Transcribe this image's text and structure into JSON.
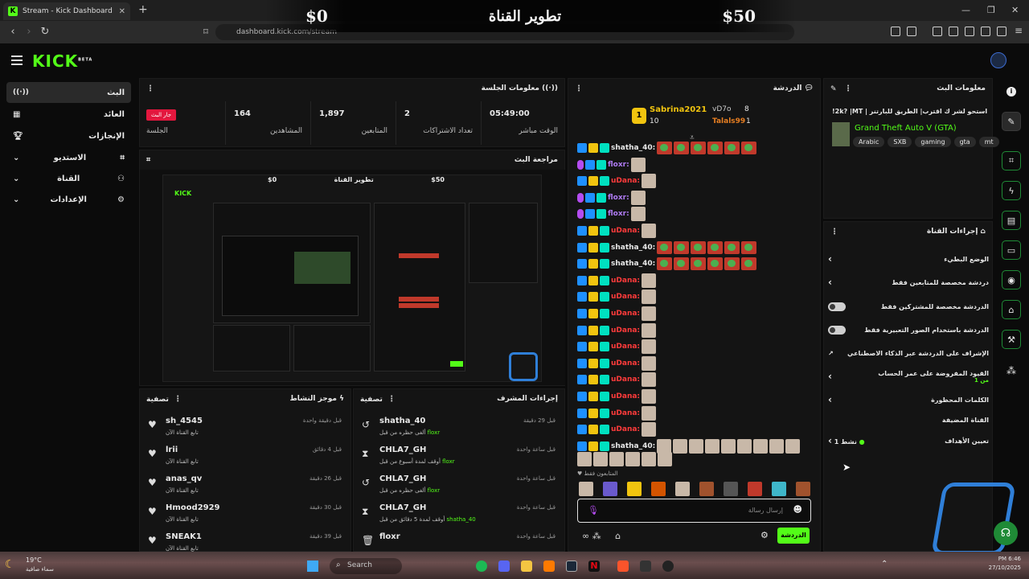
{
  "browser": {
    "tab_title": "Stream - Kick Dashboard",
    "url": "dashboard.kick.com/stream",
    "new_tab": "+"
  },
  "banner": {
    "left": "$0",
    "center": "تطوير القناة",
    "right": "$50"
  },
  "app": {
    "logo": "KICK",
    "logo_tag": "BETA"
  },
  "sidebar": {
    "items": [
      {
        "label": "البث",
        "icon": "broadcast-icon",
        "active": true
      },
      {
        "label": "العائد",
        "icon": "revenue-icon"
      },
      {
        "label": "الإنجازات",
        "icon": "trophy-icon"
      },
      {
        "label": "الاستديو",
        "icon": "studio-icon"
      },
      {
        "label": "القناة",
        "icon": "channel-icon"
      },
      {
        "label": "الإعدادات",
        "icon": "settings-icon"
      }
    ]
  },
  "session": {
    "title": "معلومات الجلسة",
    "live_badge": "جار البث",
    "session_label": "الجلسة",
    "stats": [
      {
        "value": "164",
        "label": "المشاهدين"
      },
      {
        "value": "1,897",
        "label": "المتابعين"
      },
      {
        "value": "2",
        "label": "تعداد الاشتراكات"
      },
      {
        "value": "05:49:00",
        "label": "الوقت مباشر"
      }
    ]
  },
  "preview": {
    "title": "مراجعة البث",
    "inner_left": "$0",
    "inner_center": "تطوير القناة",
    "inner_right": "$50"
  },
  "activity": {
    "title": "موجز النشاط",
    "filter": "تصفية",
    "rows": [
      {
        "name": "sh_4545",
        "sub": "تابع القناة الآن",
        "time": "قبل دقيقة واحدة"
      },
      {
        "name": "lrii",
        "sub": "تابع القناة الآن",
        "time": "قبل 4 دقائق"
      },
      {
        "name": "anas_qv",
        "sub": "تابع القناة الآن",
        "time": "قبل 26 دقيقة"
      },
      {
        "name": "Hmood2929",
        "sub": "تابع القناة الآن",
        "time": "قبل 30 دقيقة"
      },
      {
        "name": "SNEAK1",
        "sub": "تابع القناة الآن",
        "time": "قبل 39 دقيقة"
      }
    ]
  },
  "modactions": {
    "title": "إجراءات المشرف",
    "filter": "تصفية",
    "rows": [
      {
        "name": "shatha_40",
        "sub": "ألغى حظره من قبل",
        "by": "floxr",
        "time": "قبل 29 دقيقة",
        "icon": "undo-icon"
      },
      {
        "name": "CHLA7_GH",
        "sub": "أوقف لمدة أسبوع من قبل",
        "by": "floxr",
        "time": "قبل ساعة واحدة",
        "icon": "hourglass-icon"
      },
      {
        "name": "CHLA7_GH",
        "sub": "ألغى حظره من قبل",
        "by": "floxr",
        "time": "قبل ساعة واحدة",
        "icon": "undo-icon"
      },
      {
        "name": "CHLA7_GH",
        "sub": "أوقف لمدة 5 دقائق من قبل",
        "by": "shatha_40",
        "time": "قبل ساعة واحدة",
        "icon": "hourglass-icon"
      },
      {
        "name": "floxr",
        "sub": "",
        "by": "",
        "time": "قبل ساعة واحدة",
        "icon": "trash-icon"
      }
    ]
  },
  "chat": {
    "title": "الدردشة",
    "leaders": [
      {
        "name": "Sabrina2021",
        "value": "10"
      },
      {
        "name": "vD7o",
        "value": "8"
      },
      {
        "name": "Talals99",
        "value": "1"
      }
    ],
    "rank_badge": "1",
    "lines": [
      {
        "user": "shatha_40:",
        "color": "white",
        "type": "emotes"
      },
      {
        "user": "floxr:",
        "color": "purple",
        "type": "face"
      },
      {
        "user": "uDana:",
        "color": "red",
        "type": "face"
      },
      {
        "user": "floxr:",
        "color": "purple",
        "type": "face"
      },
      {
        "user": "floxr:",
        "color": "purple",
        "type": "face"
      },
      {
        "user": "uDana:",
        "color": "red",
        "type": "face"
      },
      {
        "user": "shatha_40:",
        "color": "white",
        "type": "emotes"
      },
      {
        "user": "shatha_40:",
        "color": "white",
        "type": "emotes"
      },
      {
        "user": "uDana:",
        "color": "red",
        "type": "face"
      },
      {
        "user": "uDana:",
        "color": "red",
        "type": "face"
      },
      {
        "user": "uDana:",
        "color": "red",
        "type": "face"
      },
      {
        "user": "uDana:",
        "color": "red",
        "type": "face"
      },
      {
        "user": "uDana:",
        "color": "red",
        "type": "face"
      },
      {
        "user": "uDana:",
        "color": "red",
        "type": "face"
      },
      {
        "user": "uDana:",
        "color": "red",
        "type": "face"
      },
      {
        "user": "uDana:",
        "color": "red",
        "type": "face"
      },
      {
        "user": "uDana:",
        "color": "red",
        "type": "face"
      },
      {
        "user": "uDana:",
        "color": "red",
        "type": "face"
      },
      {
        "user": "shatha_40:",
        "color": "white",
        "type": "hands"
      }
    ],
    "followers_only": "المتابعون فقط",
    "placeholder": "إرسال رسالة",
    "send": "الدردشة"
  },
  "streaminfo": {
    "title": "معلومات البث",
    "stream_title": "استحو لشر ك اقترب| الطريق للبارتنر | 2k? |MT!",
    "game": "Grand Theft Auto V (GTA)",
    "tags": [
      "Arabic",
      "SXB",
      "gaming",
      "gta",
      "mt"
    ]
  },
  "channelactions": {
    "title": "إجراءات القناة",
    "rows": [
      {
        "label": "الوضع البطيء",
        "control": "chevron"
      },
      {
        "label": "دردشة مخصصة للمتابعين فقط",
        "control": "chevron"
      },
      {
        "label": "الدردشة مخصصة للمشتركين فقط",
        "control": "toggle"
      },
      {
        "label": "الدردشة باستخدام الصور التعبيرية فقط",
        "control": "toggle"
      },
      {
        "label": "الإشراف على الدردشة عبر الذكاء الاصطناعي",
        "control": "external"
      },
      {
        "label": "القيود المفروضة على عمر الحساب",
        "sub": "من 1",
        "control": "chevron"
      },
      {
        "label": "الكلمات المحظورة",
        "control": "chevron"
      }
    ],
    "featured_title": "القناة المضيفة",
    "goals_label": "تعيين الأهداف",
    "goals_count": "نشط 1"
  },
  "taskbar": {
    "weather_temp": "19°C",
    "weather_desc": "سماء صافية",
    "search": "Search",
    "time": "PM 6:46",
    "date": "27/10/2025"
  }
}
